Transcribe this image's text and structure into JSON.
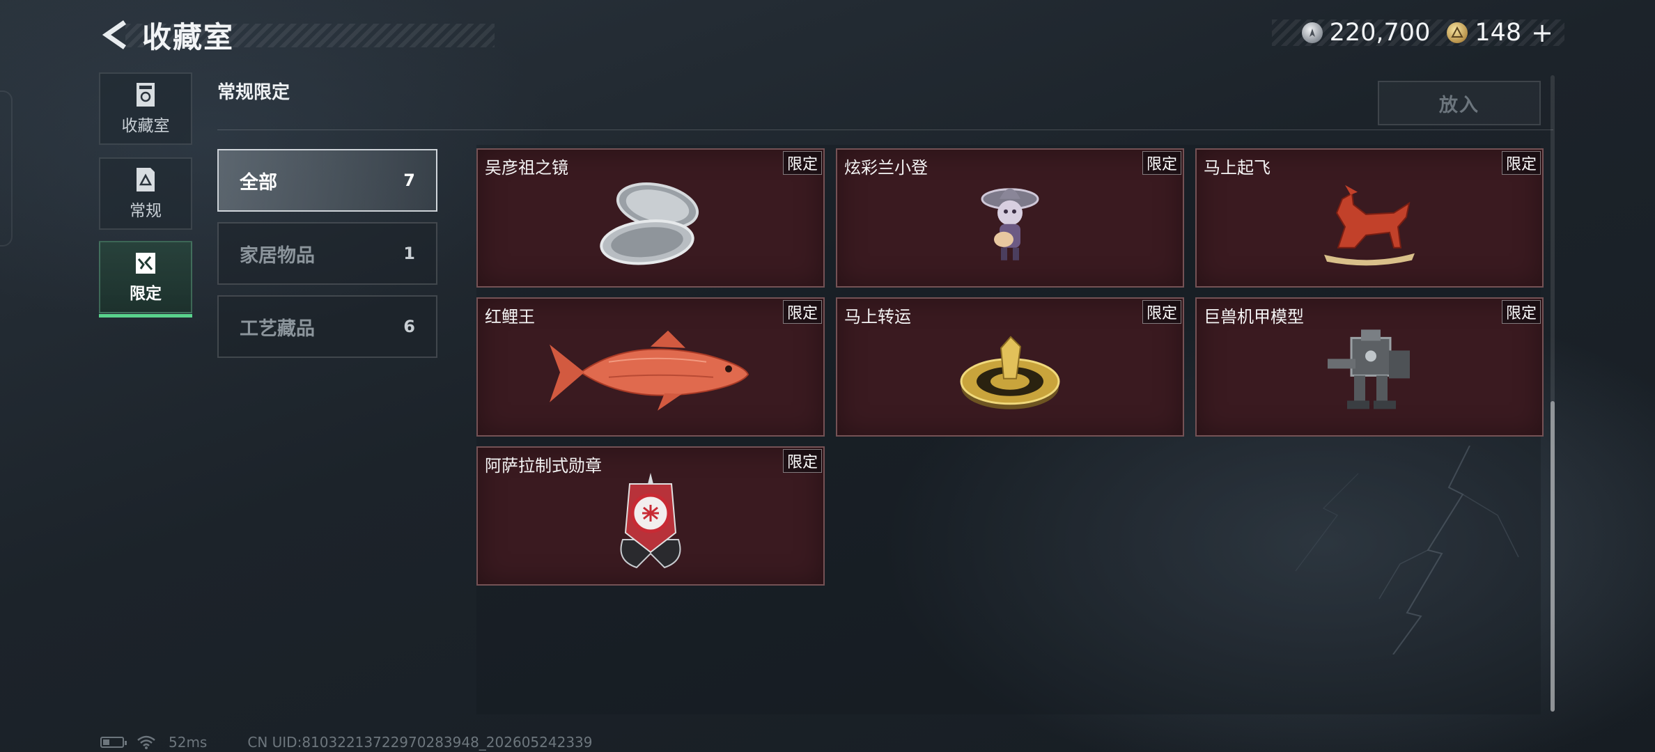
{
  "header": {
    "title": "收藏室"
  },
  "currency": {
    "silver_value": "220,700",
    "gold_value": "148",
    "plus_label": "+"
  },
  "nav": {
    "items": [
      {
        "label": "收藏室",
        "icon": "box-icon",
        "active": false
      },
      {
        "label": "常规",
        "icon": "document-icon",
        "active": false
      },
      {
        "label": "限定",
        "icon": "limited-icon",
        "active": true
      }
    ]
  },
  "section": {
    "title": "常规限定",
    "put_in_label": "放入"
  },
  "categories": [
    {
      "name": "全部",
      "count": "7",
      "active": true
    },
    {
      "name": "家居物品",
      "count": "1",
      "active": false
    },
    {
      "name": "工艺藏品",
      "count": "6",
      "active": false
    }
  ],
  "items": [
    {
      "name": "吴彦祖之镜",
      "badge": "限定",
      "icon": "compact-mirror-icon"
    },
    {
      "name": "炫彩兰小登",
      "badge": "限定",
      "icon": "mariachi-figure-icon"
    },
    {
      "name": "马上起飞",
      "badge": "限定",
      "icon": "horse-statue-icon"
    },
    {
      "name": "红鲤王",
      "badge": "限定",
      "icon": "red-carp-icon"
    },
    {
      "name": "马上转运",
      "badge": "限定",
      "icon": "fortune-wheel-icon"
    },
    {
      "name": "巨兽机甲模型",
      "badge": "限定",
      "icon": "mech-model-icon"
    },
    {
      "name": "阿萨拉制式勋章",
      "badge": "限定",
      "icon": "medal-icon"
    }
  ],
  "status": {
    "ping": "52ms",
    "uid": "CN UID:8103221372297028​3948_202605242339"
  },
  "colors": {
    "accent_green": "#59d28c",
    "card_bg": "#3a1a20"
  }
}
